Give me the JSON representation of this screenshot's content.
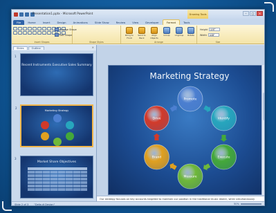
{
  "window": {
    "title": "Presentation1.pptx - Microsoft PowerPoint",
    "context_tab": "Drawing Tools",
    "controls": [
      "–",
      "□",
      "×"
    ]
  },
  "tabs": [
    {
      "label": "File"
    },
    {
      "label": "Home"
    },
    {
      "label": "Insert"
    },
    {
      "label": "Design"
    },
    {
      "label": "Animations"
    },
    {
      "label": "Slide Show"
    },
    {
      "label": "Review"
    },
    {
      "label": "View"
    },
    {
      "label": "Developer"
    },
    {
      "label": "Format"
    },
    {
      "label": "Tools"
    }
  ],
  "ribbon": {
    "shapes_label": "Insert Shapes",
    "change_shape": "Change Shape",
    "edit_shape": "Edit Shape",
    "styles_label": "Shape Styles",
    "arrange_label": "Arrange",
    "bring_forward": "Bring to Front",
    "send_backward": "Send to Back",
    "align": "Align Objects",
    "group": "Group",
    "ungroup": "Ungroup",
    "rotate": "Rotate",
    "height_label": "Height",
    "height_value": "3.97\"",
    "width_label": "Width",
    "width_value": "4.08\"",
    "size_label": "Size"
  },
  "left_pane": {
    "tabs": [
      "Slides",
      "Outline"
    ],
    "close": "×",
    "thumbnails": [
      {
        "num": "1",
        "title": "Recent Instruments Executive Sales Summary"
      },
      {
        "num": "2",
        "title": "Marketing Strategy"
      },
      {
        "num": "3",
        "title": "Market Share Objectives"
      }
    ]
  },
  "slide": {
    "title": "Marketing Strategy",
    "nodes": [
      {
        "label": "Promote",
        "color": "#4c7fd0"
      },
      {
        "label": "Identify",
        "color": "#27a6bd"
      },
      {
        "label": "Execute",
        "color": "#44a83a"
      },
      {
        "label": "Measure",
        "color": "#6fb83a"
      },
      {
        "label": "Brand",
        "color": "#e0a020"
      },
      {
        "label": "Drive",
        "color": "#d23a2a"
      }
    ]
  },
  "notes": {
    "text": "Our strategy focuses on key accounts targeted to maintain our position in the traditional music dealer, while simultaneously developing new distributions that will promote our instrument product and the additionally build up new markets."
  },
  "status": {
    "slide": "Slide 2 of 3",
    "theme": "\"Default Design\"",
    "zoom": "50%"
  }
}
